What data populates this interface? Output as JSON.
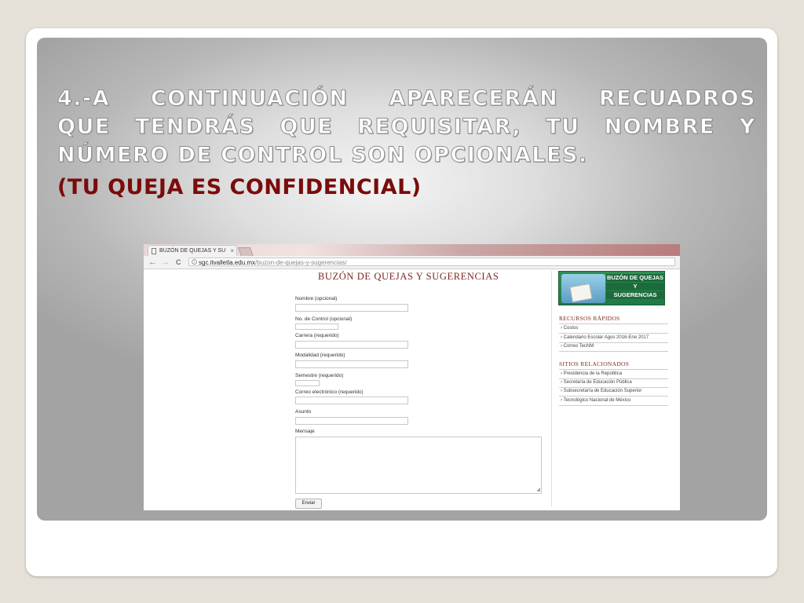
{
  "slide": {
    "title_line1": [
      "4.-A",
      "CONTINUACIÓN",
      "APARECERÁN",
      "RECUADROS"
    ],
    "title_line2": [
      "QUE",
      "TENDRÁS",
      "QUE",
      "REQUISITAR,",
      "TU",
      "NOMBRE",
      "Y"
    ],
    "title_line3": "NÚMERO DE CONTROL SON OPCIONALES.",
    "subtitle": "(TU QUEJA ES CONFIDENCIAL)"
  },
  "browser": {
    "tab_title": "BUZÓN DE QUEJAS Y SU",
    "tab_close": "×",
    "nav": {
      "back": "←",
      "forward": "→",
      "reload": "C"
    },
    "url_host": "sgc.itvalletla.edu.mx",
    "url_path": "/buzon-de-quejas-y-sugerencias/",
    "info_icon": "i"
  },
  "page": {
    "title": "BUZÓN DE QUEJAS Y SUGERENCIAS",
    "fields": {
      "nombre": "Nombre (opcional)",
      "control": "No. de Control (opcional)",
      "carrera": "Carrera (requerido)",
      "modalidad": "Modalidad (requerido)",
      "semestre": "Semestre (requerido)",
      "correo": "Correo electrónico (requerido)",
      "asunto": "Asunto",
      "mensaje": "Mensaje"
    },
    "submit": "Enviar"
  },
  "sidebar": {
    "banner": [
      "BUZÓN DE QUEJAS",
      "Y",
      "SUGERENCIAS"
    ],
    "recursos_heading": "RECURSOS RÁPIDOS",
    "recursos": [
      "Costos",
      "Calendario Escolar Agos 2016-Ene 2017",
      "Correo TecNM"
    ],
    "sitios_heading": "SITIOS RELACIONADOS",
    "sitios": [
      "Presidencia de la República",
      "Secretaría de Educación Pública",
      "Subsecretaría de Educación Superior",
      "Tecnológico Nacional de México"
    ]
  },
  "colors": {
    "title_text": "#ffffff",
    "subtitle_text": "#7a0c0c",
    "page_heading": "#7a2a22",
    "banner_green": "#1f7a45"
  }
}
